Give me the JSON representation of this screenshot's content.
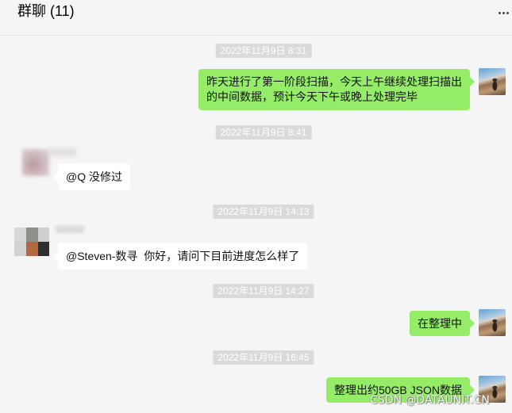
{
  "header": {
    "title": "群聊 (11)"
  },
  "chat": {
    "items": [
      {
        "timestamp": "2022年11月9日 8:31"
      },
      {
        "outgoing": "昨天进行了第一阶段扫描，今天上午继续处理扫描出的中间数据，预计今天下午或晚上处理完毕"
      },
      {
        "timestamp": "2022年11月9日 8:41"
      },
      {
        "incoming": "@Q 没修过"
      },
      {
        "timestamp": "2022年11月9日 14:13"
      },
      {
        "incoming": "@Steven-数寻  你好，请问下目前进度怎么样了"
      },
      {
        "timestamp": "2022年11月9日 14:27"
      },
      {
        "outgoing": "在整理中"
      },
      {
        "timestamp": "2022年11月9日 16:45"
      },
      {
        "outgoing": "整理出约50GB JSON数据"
      }
    ]
  },
  "watermark": "CSDN @DATAUNIT.CN",
  "icons": {
    "header_more": "ellipsis-icon"
  },
  "theme": {
    "background": "#f5f5f5",
    "divider": "#e4e4e4",
    "outgoing_bubble": "#95ec69",
    "incoming_bubble": "#ffffff",
    "timestamp_background": "#dadada",
    "timestamp_text": "#ffffff"
  }
}
